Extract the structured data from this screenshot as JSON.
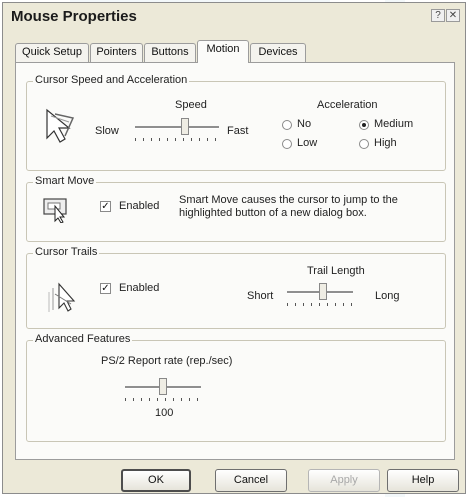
{
  "window": {
    "title": "Mouse Properties",
    "help_glyph": "?",
    "close_glyph": "✕"
  },
  "tabs": [
    {
      "label": "Quick Setup"
    },
    {
      "label": "Pointers"
    },
    {
      "label": "Buttons"
    },
    {
      "label": "Motion"
    },
    {
      "label": "Devices"
    }
  ],
  "speed": {
    "group_label": "Cursor Speed and Acceleration",
    "speed_label": "Speed",
    "slow_label": "Slow",
    "fast_label": "Fast",
    "speed_value": 0.6,
    "acceleration_label": "Acceleration",
    "options": [
      {
        "label": "No",
        "selected": false
      },
      {
        "label": "Medium",
        "selected": true
      },
      {
        "label": "Low",
        "selected": false
      },
      {
        "label": "High",
        "selected": false
      }
    ]
  },
  "smart_move": {
    "group_label": "Smart Move",
    "enabled_label": "Enabled",
    "enabled": true,
    "description": "Smart Move causes the cursor to jump to the highlighted button of a new dialog box."
  },
  "trails": {
    "group_label": "Cursor Trails",
    "enabled_label": "Enabled",
    "enabled": true,
    "trail_length_label": "Trail Length",
    "short_label": "Short",
    "long_label": "Long",
    "trail_value": 0.55
  },
  "advanced": {
    "group_label": "Advanced Features",
    "report_rate_label": "PS/2 Report rate (rep./sec)",
    "report_rate_value": "100"
  },
  "buttons": {
    "ok": "OK",
    "cancel": "Cancel",
    "apply": "Apply",
    "help": "Help"
  }
}
